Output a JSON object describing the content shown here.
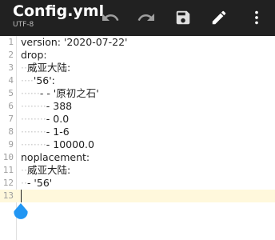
{
  "toolbar": {
    "title": "Config.yml",
    "encoding": "UTF-8",
    "icons": {
      "undo": "undo-icon",
      "redo": "redo-icon",
      "save": "save-icon",
      "edit": "edit-icon",
      "more": "more-vert-icon"
    }
  },
  "editor": {
    "current_line": 13,
    "lines": [
      {
        "num": "1",
        "indent": "",
        "text": "version: '2020-07-22'"
      },
      {
        "num": "2",
        "indent": "",
        "text": "drop:"
      },
      {
        "num": "3",
        "indent": "··",
        "text": "威亚大陆:"
      },
      {
        "num": "4",
        "indent": "····",
        "text": "'56':"
      },
      {
        "num": "5",
        "indent": "······",
        "text": "- - '原初之石'"
      },
      {
        "num": "6",
        "indent": "········",
        "text": "- 388"
      },
      {
        "num": "7",
        "indent": "········",
        "text": "- 0.0"
      },
      {
        "num": "8",
        "indent": "········",
        "text": "- 1-6"
      },
      {
        "num": "9",
        "indent": "········",
        "text": "- 10000.0"
      },
      {
        "num": "10",
        "indent": "",
        "text": "noplacement:"
      },
      {
        "num": "11",
        "indent": "··",
        "text": "威亚大陆:"
      },
      {
        "num": "12",
        "indent": "··",
        "text": "- '56'"
      },
      {
        "num": "13",
        "indent": "",
        "text": ""
      }
    ]
  },
  "colors": {
    "toolbar_bg": "#212121",
    "current_line_bg": "#fff8dc",
    "cursor_handle": "#2196f3"
  }
}
